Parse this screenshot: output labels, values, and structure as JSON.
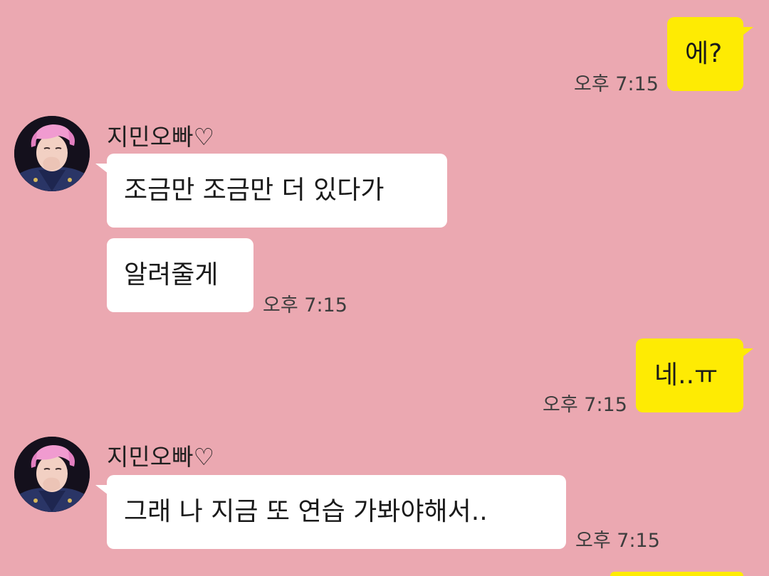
{
  "colors": {
    "background": "#EBA8B1",
    "outgoing_bubble": "#FEEB03",
    "incoming_bubble": "#FFFFFF"
  },
  "contact": {
    "name": "지민오빠♡",
    "avatar": "profile-photo-pink-hair"
  },
  "messages": [
    {
      "direction": "out",
      "text": "에?",
      "time": "오후 7:15"
    },
    {
      "direction": "in",
      "text": "조금만 조금만 더 있다가",
      "time": ""
    },
    {
      "direction": "in",
      "text": "알려줄게",
      "time": "오후 7:15"
    },
    {
      "direction": "out",
      "text": "네..ㅠ",
      "time": "오후 7:15"
    },
    {
      "direction": "in",
      "text": "그래 나 지금 또 연습 가봐야해서..",
      "time": "오후 7:15"
    }
  ]
}
